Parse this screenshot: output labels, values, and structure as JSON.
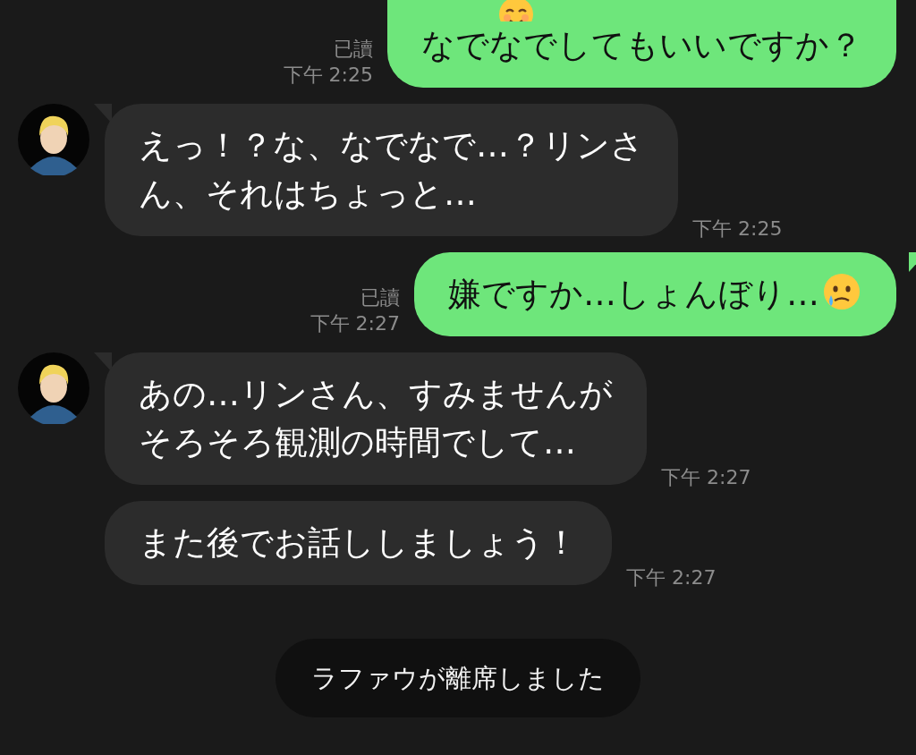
{
  "messages": [
    {
      "kind": "outgoing",
      "lines": [
        "なでなでしてもいいですか？"
      ],
      "cut_top": true,
      "emoji": true,
      "read": "已讀",
      "time": "下午 2:25"
    },
    {
      "kind": "incoming",
      "lines": [
        "えっ！？な、なでなで…？リンさ",
        "ん、それはちょっと…"
      ],
      "show_avatar": true,
      "time": "下午 2:25"
    },
    {
      "kind": "outgoing",
      "lines": [
        "嫌ですか…しょんぼり…"
      ],
      "cut_top": false,
      "emoji": true,
      "read": "已讀",
      "time": "下午 2:27"
    },
    {
      "kind": "incoming",
      "lines": [
        "あの…リンさん、すみませんが",
        "そろそろ観測の時間でして…"
      ],
      "show_avatar": true,
      "time": "下午 2:27"
    },
    {
      "kind": "incoming",
      "lines": [
        "また後でお話ししましょう！"
      ],
      "show_avatar": false,
      "time": "下午 2:27"
    }
  ],
  "system_notice": "ラファウが離席しました"
}
